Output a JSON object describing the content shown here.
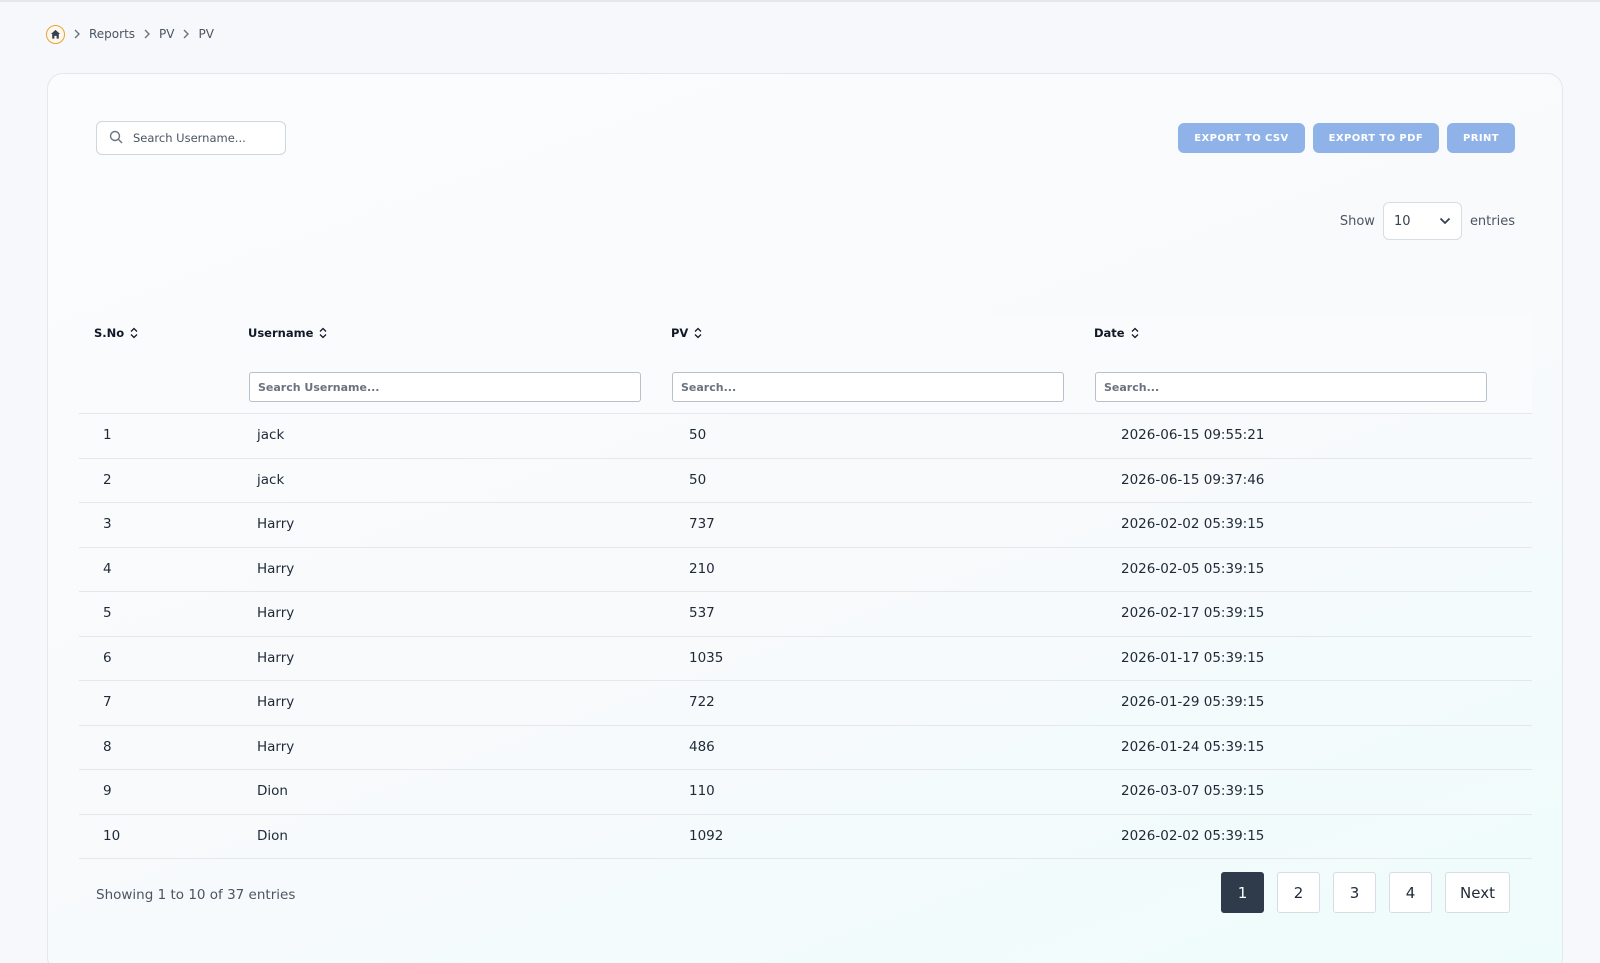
{
  "breadcrumb": {
    "items": [
      "Reports",
      "PV",
      "PV"
    ]
  },
  "toolbar": {
    "search_placeholder": "Search Username...",
    "export_csv": "EXPORT TO CSV",
    "export_pdf": "EXPORT TO PDF",
    "print": "PRINT"
  },
  "entries": {
    "show_label": "Show",
    "selected": "10",
    "entries_label": "entries"
  },
  "table": {
    "headers": [
      "S.No",
      "Username",
      "PV",
      "Date"
    ],
    "filters": {
      "username_placeholder": "Search Username...",
      "pv_placeholder": "Search...",
      "date_placeholder": "Search..."
    },
    "rows": [
      {
        "sno": "1",
        "username": "jack",
        "pv": "50",
        "date": "2026-06-15 09:55:21"
      },
      {
        "sno": "2",
        "username": "jack",
        "pv": "50",
        "date": "2026-06-15 09:37:46"
      },
      {
        "sno": "3",
        "username": "Harry",
        "pv": "737",
        "date": "2026-02-02 05:39:15"
      },
      {
        "sno": "4",
        "username": "Harry",
        "pv": "210",
        "date": "2026-02-05 05:39:15"
      },
      {
        "sno": "5",
        "username": "Harry",
        "pv": "537",
        "date": "2026-02-17 05:39:15"
      },
      {
        "sno": "6",
        "username": "Harry",
        "pv": "1035",
        "date": "2026-01-17 05:39:15"
      },
      {
        "sno": "7",
        "username": "Harry",
        "pv": "722",
        "date": "2026-01-29 05:39:15"
      },
      {
        "sno": "8",
        "username": "Harry",
        "pv": "486",
        "date": "2026-01-24 05:39:15"
      },
      {
        "sno": "9",
        "username": "Dion",
        "pv": "110",
        "date": "2026-03-07 05:39:15"
      },
      {
        "sno": "10",
        "username": "Dion",
        "pv": "1092",
        "date": "2026-02-02 05:39:15"
      }
    ]
  },
  "footer": {
    "showing": "Showing 1 to 10 of 37 entries",
    "pages": [
      "1",
      "2",
      "3",
      "4"
    ],
    "active_page": "1",
    "next_label": "Next"
  },
  "colors": {
    "accent_button": "#8fb3e8",
    "active_page": "#2f3a4b",
    "home_icon": "#e3a53a"
  }
}
